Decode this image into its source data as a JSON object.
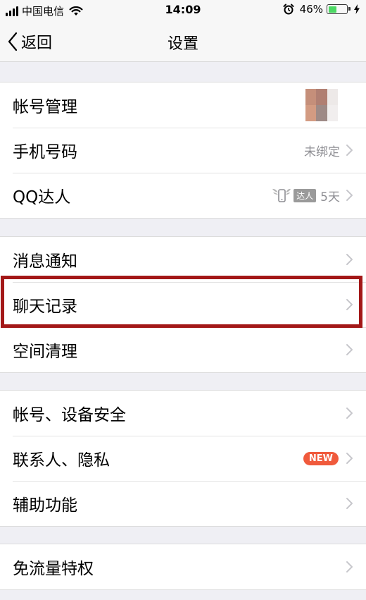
{
  "status_bar": {
    "carrier": "中国电信",
    "time": "14:09",
    "battery": "46%",
    "battery_level": 0.46,
    "battery_color": "#4cd964"
  },
  "nav": {
    "back_label": "返回",
    "title": "设置"
  },
  "groups": [
    {
      "items": [
        {
          "label": "帐号管理",
          "accessory": "avatar"
        },
        {
          "label": "手机号码",
          "value": "未绑定"
        },
        {
          "label": "QQ达人",
          "talent_tag": "达人",
          "talent_days": "5天"
        }
      ]
    },
    {
      "items": [
        {
          "label": "消息通知"
        },
        {
          "label": "聊天记录",
          "highlighted": true
        },
        {
          "label": "空间清理"
        }
      ]
    },
    {
      "items": [
        {
          "label": "帐号、设备安全"
        },
        {
          "label": "联系人、隐私",
          "badge": "NEW"
        },
        {
          "label": "辅助功能"
        }
      ]
    },
    {
      "items": [
        {
          "label": "免流量特权"
        }
      ]
    }
  ],
  "colors": {
    "highlight": "#a31818",
    "badge": "#f05a3c",
    "background": "#efeff4"
  },
  "icons": [
    "signal-icon",
    "wifi-icon",
    "alarm-icon",
    "battery-icon",
    "charging-icon",
    "back-chevron-icon",
    "chevron-right-icon",
    "winged-phone-icon"
  ]
}
